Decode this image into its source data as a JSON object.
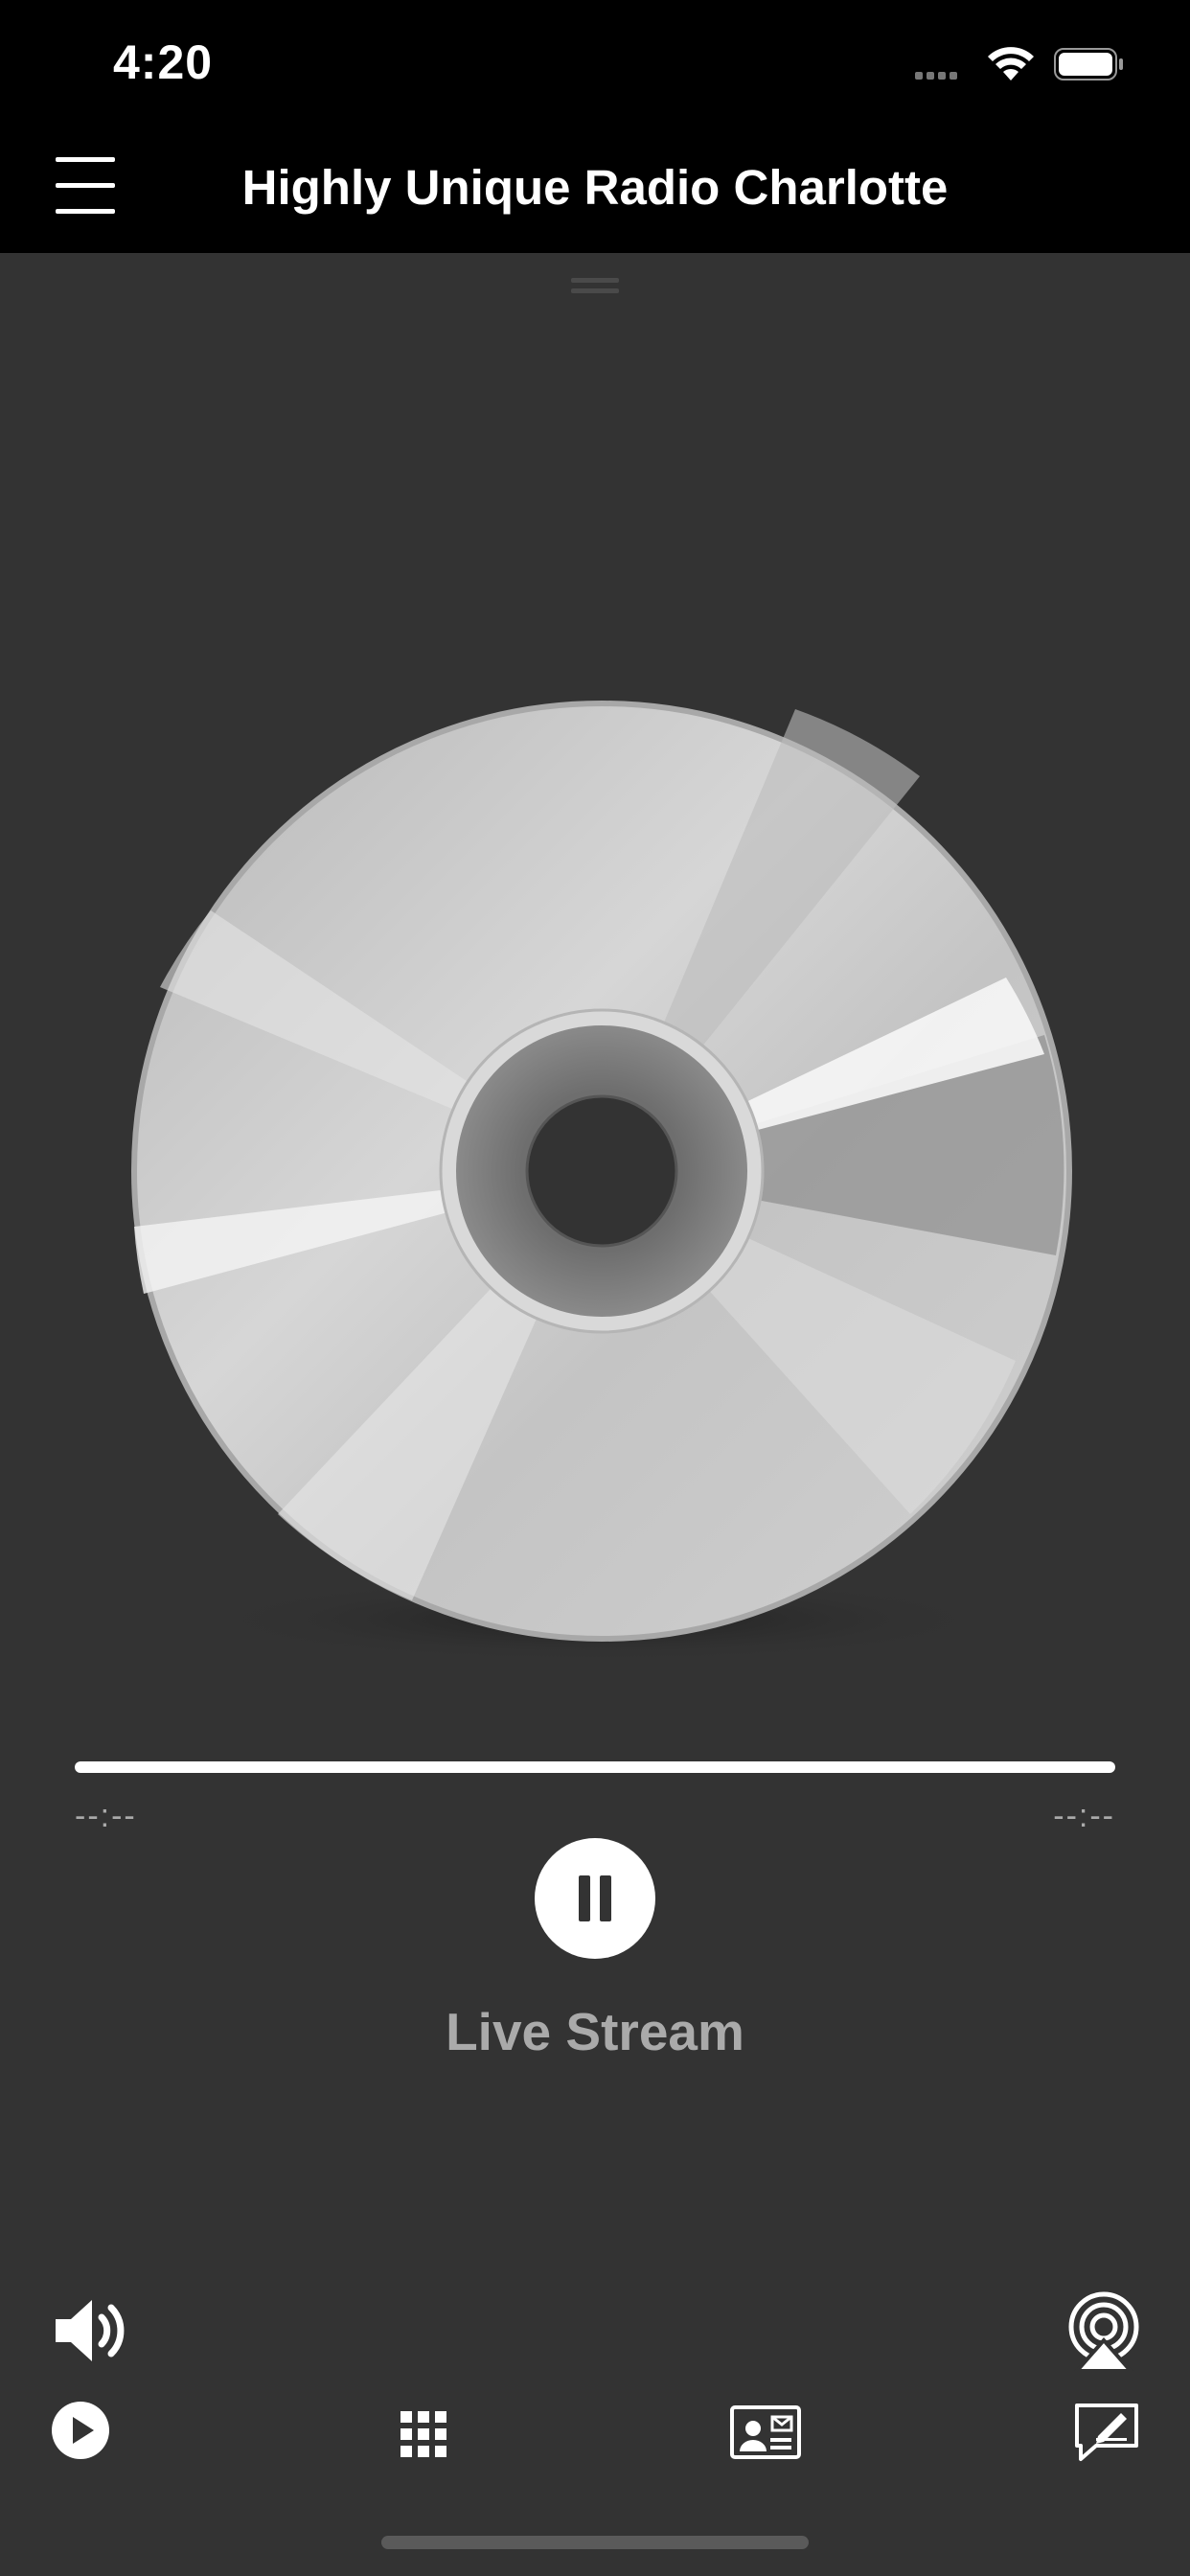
{
  "status_bar": {
    "time": "4:20"
  },
  "header": {
    "title": "Highly Unique Radio Charlotte"
  },
  "player": {
    "elapsed": "--:--",
    "remaining": "--:--",
    "progress": 1.0,
    "state": "playing",
    "stream_label": "Live Stream"
  },
  "controls": {
    "volume_icon": "speaker-icon",
    "airplay_icon": "airplay-icon"
  },
  "tab_bar": [
    {
      "icon": "play-circle-icon"
    },
    {
      "icon": "grid-icon"
    },
    {
      "icon": "contact-card-icon"
    },
    {
      "icon": "feedback-icon"
    }
  ],
  "colors": {
    "background": "#333333",
    "bar": "#000000",
    "muted_text": "#aaaaaa"
  }
}
